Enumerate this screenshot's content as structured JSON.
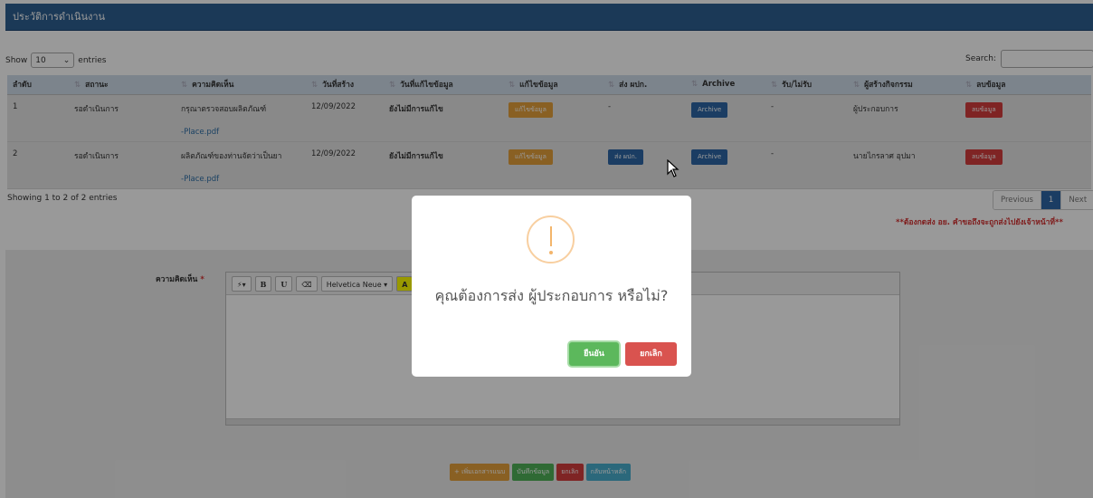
{
  "header": {
    "title": "ประวัติการดำเนินงาน"
  },
  "length": {
    "show": "Show",
    "value": "10",
    "entries": "entries"
  },
  "search": {
    "label": "Search:"
  },
  "table": {
    "columns": [
      "ลำดับ",
      "สถานะ",
      "ความคิดเห็น",
      "วันที่สร้าง",
      "วันที่แก้ไขข้อมูล",
      "แก้ไขข้อมูล",
      "ส่ง ผปก.",
      "Archive",
      "รับ/ไม่รับ",
      "ผู้สร้างกิจกรรม",
      "ลบข้อมูล"
    ],
    "rows": [
      {
        "no": "1",
        "status": "รอดำเนินการ",
        "comment": "กรุณาตรวจสอบผลิตภัณฑ์",
        "file": "-Place.pdf",
        "created": "12/09/2022",
        "modified": "ยังไม่มีการแก้ไข",
        "edit": "แก้ไขข้อมูล",
        "send": "-",
        "archive": "Archive",
        "accept": "-",
        "creator": "ผู้ประกอบการ",
        "delete": "ลบข้อมูล"
      },
      {
        "no": "2",
        "status": "รอดำเนินการ",
        "comment": "ผลิตภัณฑ์ของท่านจัดว่าเป็นยา",
        "file": "-Place.pdf",
        "created": "12/09/2022",
        "modified": "ยังไม่มีการแก้ไข",
        "edit": "แก้ไขข้อมูล",
        "send": "ส่ง ผปก.",
        "archive": "Archive",
        "accept": "-",
        "creator": "นายไกรลาศ อุปมา",
        "delete": "ลบข้อมูล"
      }
    ]
  },
  "info": "Showing 1 to 2 of 2 entries",
  "pager": {
    "prev": "Previous",
    "page": "1",
    "next": "Next"
  },
  "note": "**ต้องกดส่ง อย. คำขอถึงจะถูกส่งไปยังเจ้าหน้าที่**",
  "form": {
    "label": "ความคิดเห็น",
    "required": "*",
    "toolbar": {
      "magic": "⚡▾",
      "bold": "B",
      "underline": "U",
      "eraser": "⌫",
      "font": "Helvetica Neue ▾",
      "color": "A"
    }
  },
  "actions": {
    "attach": "+ เพิ่มเอกสารแนบ",
    "save": "บันทึกข้อมูล",
    "cancel": "ยกเลิก",
    "back": "กลับหน้าหลัก"
  },
  "modal": {
    "message": "คุณต้องการส่ง ผู้ประกอบการ หรือไม่?",
    "confirm": "ยืนยัน",
    "cancel": "ยกเลิก",
    "icon": "warning-icon"
  },
  "colors": {
    "header": "#2e5f91",
    "edit": "#e5a03b",
    "send": "#2d67a6",
    "delete": "#d43c3c",
    "confirm": "#5cb85c",
    "cancel": "#d9534f",
    "note": "#d43030"
  }
}
